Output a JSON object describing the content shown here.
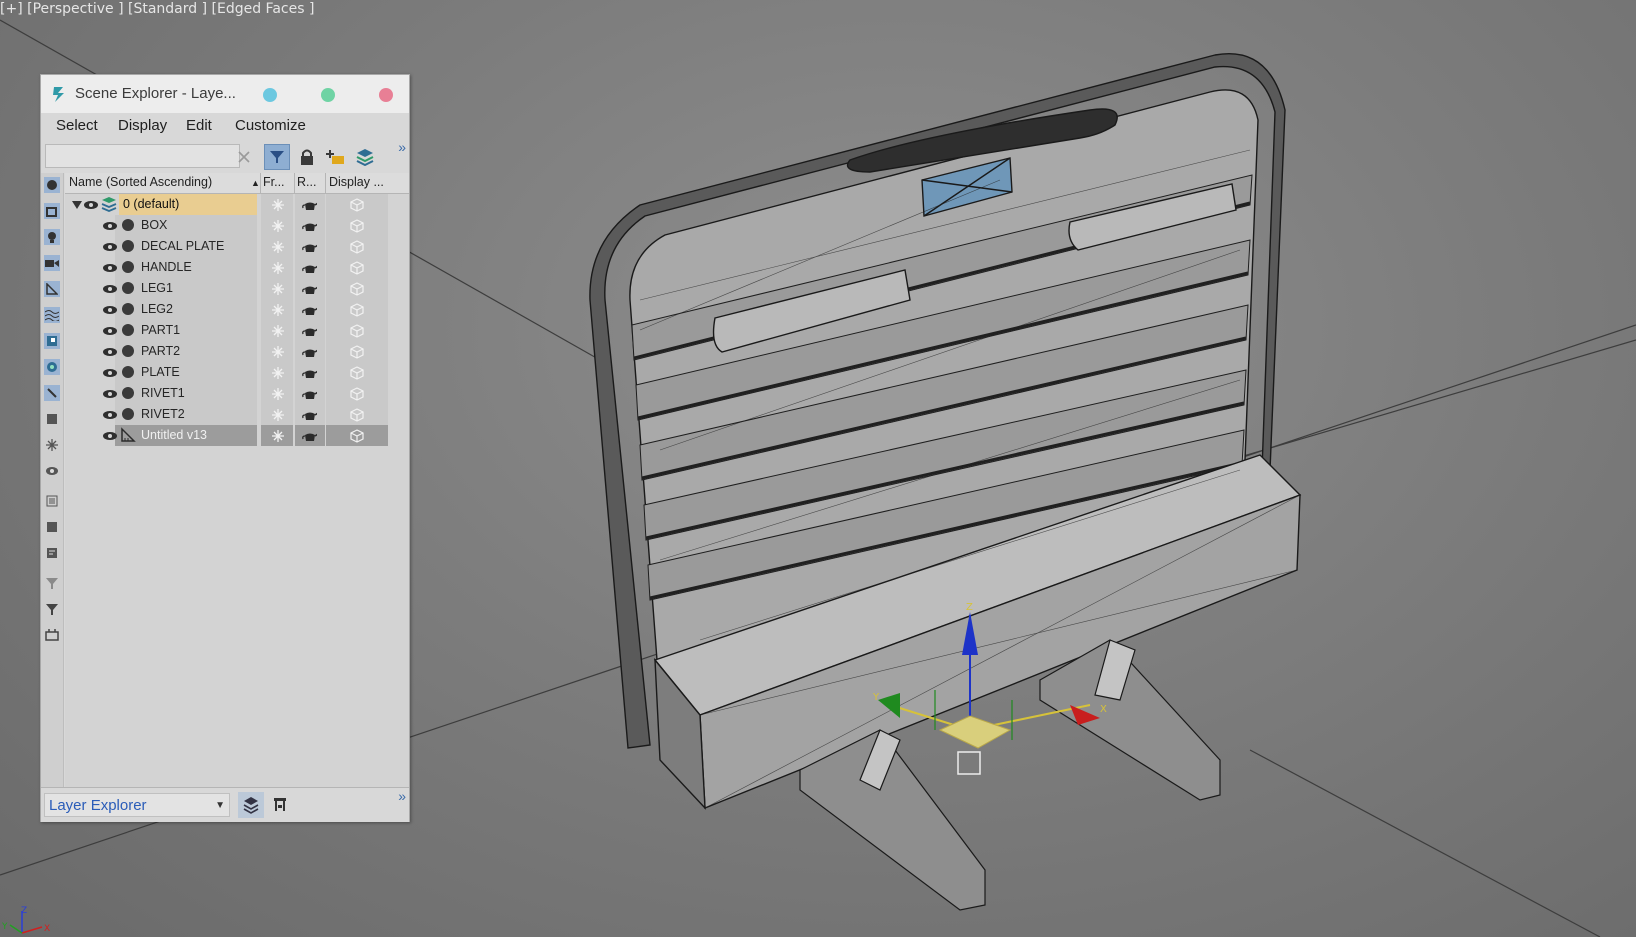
{
  "viewport": {
    "label": "[+] [Perspective ] [Standard ] [Edged Faces ]"
  },
  "explorer": {
    "title": "Scene Explorer - Laye...",
    "menu": [
      "Select",
      "Display",
      "Edit",
      "Customize"
    ],
    "search": {
      "value": "",
      "placeholder": ""
    },
    "columns": {
      "name": "Name (Sorted Ascending)",
      "freeze": "Fr...",
      "render": "R...",
      "display": "Display ..."
    },
    "layer": {
      "name": "0 (default)"
    },
    "objects": [
      {
        "name": "BOX",
        "type": "geometry"
      },
      {
        "name": "DECAL PLATE",
        "type": "geometry"
      },
      {
        "name": "HANDLE",
        "type": "geometry"
      },
      {
        "name": "LEG1",
        "type": "geometry"
      },
      {
        "name": "LEG2",
        "type": "geometry"
      },
      {
        "name": "PART1",
        "type": "geometry"
      },
      {
        "name": "PART2",
        "type": "geometry"
      },
      {
        "name": "PLATE",
        "type": "geometry"
      },
      {
        "name": "RIVET1",
        "type": "geometry"
      },
      {
        "name": "RIVET2",
        "type": "geometry"
      },
      {
        "name": "Untitled v13",
        "type": "helper",
        "selected": true
      }
    ],
    "bottom": {
      "explorer_type": "Layer Explorer"
    }
  },
  "axis": {
    "z": "Z",
    "x": "X",
    "y": "Y"
  },
  "gizmo": {
    "x": "X",
    "y": "Y",
    "z": "Z"
  },
  "colors": {
    "title_dot_1": "#6cc8e0",
    "title_dot_2": "#6fd3a4",
    "title_dot_3": "#e87f95",
    "layer_highlight": "#e9cd91",
    "selected_row": "#9c9c9c",
    "accent": "#8eaed2"
  }
}
